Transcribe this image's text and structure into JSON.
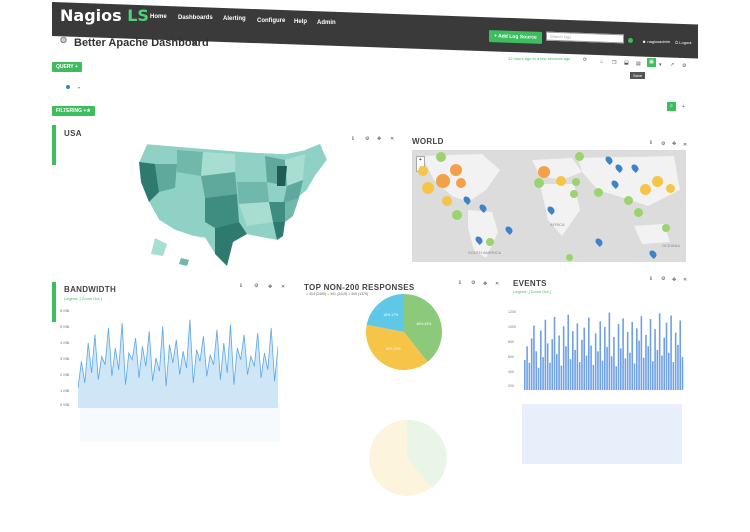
{
  "app": {
    "logo_main": "Nagios",
    "logo_suffix": "LS"
  },
  "nav": {
    "items": [
      "Home",
      "Dashboards",
      "Alerting",
      "Configure",
      "Help",
      "Admin"
    ]
  },
  "header_right": {
    "add_log_source": "Add Log Source",
    "search_placeholder": "Search logs",
    "user": "nagiosadmin",
    "logout": "Logout"
  },
  "dashboard": {
    "title": "Better Apache Dashboard",
    "time_range": "12 hours ago to a few seconds ago",
    "query_label": "QUERY",
    "filtering_label": "FILTERING",
    "tooltip": "Save"
  },
  "panels": {
    "usa": {
      "title": "USA"
    },
    "world": {
      "title": "WORLD",
      "map_labels": [
        "AFRICA",
        "SOUTH AMERICA",
        "OCEANIA"
      ]
    },
    "bandwidth": {
      "title": "BANDWIDTH",
      "sub": "Legend: [  Zoom Out ]",
      "y_ticks": [
        "6 MB",
        "5 MB",
        "4 MB",
        "3 MB",
        "2 MB",
        "1 MB",
        "0 MB"
      ]
    },
    "responses": {
      "title": "TOP NON-200 RESPONSES",
      "legend": [
        "404 (2469)",
        "301 (2419)",
        "400 (1376)"
      ],
      "labels": [
        "46% 43%",
        "38% 19%",
        "18% 17%"
      ]
    },
    "events": {
      "title": "EVENTS",
      "sub": "Legend: [  Zoom Out ]",
      "y_ticks": [
        "1200",
        "1000",
        "800",
        "600",
        "400",
        "200"
      ]
    }
  },
  "chart_data": [
    {
      "type": "line",
      "title": "BANDWIDTH",
      "ylabel": "MB",
      "ylim": [
        0,
        6
      ],
      "series": [
        {
          "values": [
            1.2,
            2.8,
            1.5,
            3.9,
            2.1,
            4.4,
            1.7,
            3.1,
            2.6,
            4.8,
            1.9,
            3.6,
            2.3,
            5.1,
            1.4,
            3.3,
            2.9,
            4.2,
            1.8,
            3.7,
            2.5,
            4.6,
            1.6,
            3.0,
            2.2,
            4.9,
            1.3,
            3.8,
            2.7,
            4.1,
            2.0,
            3.4,
            2.4,
            5.3,
            1.5,
            3.5,
            2.8,
            4.3,
            1.9,
            3.2,
            2.6,
            4.7,
            1.7,
            3.9,
            2.1,
            5.0,
            1.4,
            3.6,
            2.9,
            4.4,
            2.0,
            3.1,
            2.5,
            4.5,
            1.8,
            3.3,
            2.3,
            4.8,
            1.6,
            3.7
          ]
        }
      ]
    },
    {
      "type": "pie",
      "title": "TOP NON-200 RESPONSES",
      "categories": [
        "404",
        "301",
        "400"
      ],
      "values": [
        2469,
        2419,
        1376
      ],
      "colors": [
        "#8cc97b",
        "#f6c447",
        "#5fc8e6"
      ]
    },
    {
      "type": "bar",
      "title": "EVENTS",
      "ylim": [
        0,
        1200
      ],
      "values": [
        420,
        610,
        380,
        720,
        900,
        540,
        310,
        830,
        460,
        980,
        650,
        380,
        710,
        1020,
        500,
        760,
        340,
        890,
        610,
        1050,
        430,
        820,
        560,
        930,
        390,
        700,
        870,
        480,
        1010,
        620,
        350,
        790,
        540,
        960,
        410,
        880,
        600,
        1080,
        470,
        740,
        330,
        920,
        580,
        1000,
        440,
        810,
        520,
        950,
        370,
        860,
        690,
        1030,
        450,
        770,
        610,
        990,
        400,
        850,
        560,
        1070,
        480,
        730,
        940,
        520,
        1040,
        390,
        800,
        630,
        970,
        460
      ]
    }
  ]
}
